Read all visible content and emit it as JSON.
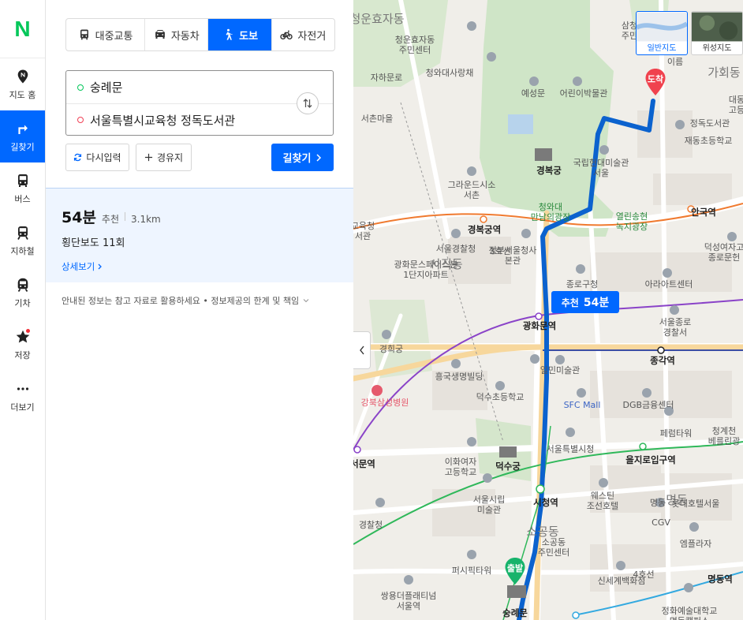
{
  "rail": {
    "logo": "N",
    "items": [
      {
        "icon": "map-pin-icon",
        "label": "지도 홈"
      },
      {
        "icon": "directions-icon",
        "label": "길찾기"
      },
      {
        "icon": "bus-icon",
        "label": "버스"
      },
      {
        "icon": "subway-icon",
        "label": "지하철"
      },
      {
        "icon": "train-icon",
        "label": "기차"
      },
      {
        "icon": "star-icon",
        "label": "저장"
      },
      {
        "icon": "more-icon",
        "label": "더보기"
      }
    ]
  },
  "modes": [
    {
      "icon": "bus-icon",
      "label": "대중교통"
    },
    {
      "icon": "car-icon",
      "label": "자동차"
    },
    {
      "icon": "walk-icon",
      "label": "도보"
    },
    {
      "icon": "bicycle-icon",
      "label": "자전거"
    }
  ],
  "route": {
    "origin": "숭례문",
    "destination": "서울특별시교육청 정독도서관"
  },
  "actions": {
    "reset_label": "다시입력",
    "waypoint_label": "경유지",
    "search_label": "길찾기"
  },
  "result": {
    "time": "54분",
    "recommend": "추천",
    "distance": "3.1km",
    "crosswalks": "횡단보도 11회",
    "detail_label": "상세보기"
  },
  "notice": "안내된 정보는 참고 자료로 활용하세요 • 정보제공의 한계 및 책임",
  "map": {
    "layers": [
      {
        "label": "일반지도",
        "active": true
      },
      {
        "label": "위성지도",
        "active": false
      }
    ],
    "route_badge": {
      "tag": "추천",
      "time": "54분"
    },
    "start_pin": "출발",
    "end_pin": "도착",
    "labels": [
      {
        "text": "청운효자동",
        "cls": "big"
      },
      {
        "text": "청운효자동\n주민센터"
      },
      {
        "text": "청와대사랑채"
      },
      {
        "text": "예성문"
      },
      {
        "text": "어린이박물관"
      },
      {
        "text": "서촌마을"
      },
      {
        "text": "경복궁",
        "cls": "bold"
      },
      {
        "text": "국립현대미술관\n서울"
      },
      {
        "text": "그라운드시소\n서촌"
      },
      {
        "text": "청와대\n만남의광장",
        "cls": "green"
      },
      {
        "text": "열린송현\n녹지광장",
        "cls": "green"
      },
      {
        "text": "경복궁역",
        "cls": "bold"
      },
      {
        "text": "안국역",
        "cls": "bold"
      },
      {
        "text": "서울경찰청"
      },
      {
        "text": "정부서울청사\n본관"
      },
      {
        "text": "광화문스페이스본\n1단지아파트"
      },
      {
        "text": "사직동",
        "cls": "big"
      },
      {
        "text": "종로구청"
      },
      {
        "text": "아라아트센터"
      },
      {
        "text": "광화문역",
        "cls": "bold"
      },
      {
        "text": "종각역",
        "cls": "bold"
      },
      {
        "text": "서울종로\n경찰서"
      },
      {
        "text": "경희궁"
      },
      {
        "text": "흥국생명빌딩"
      },
      {
        "text": "일민미술관"
      },
      {
        "text": "덕수초등학교"
      },
      {
        "text": "SFC Mall",
        "cls": "blue"
      },
      {
        "text": "DGB금융센터"
      },
      {
        "text": "강북삼성병원",
        "cls": "red"
      },
      {
        "text": "페럼타워"
      },
      {
        "text": "서울특별시청"
      },
      {
        "text": "을지로입구역",
        "cls": "bold"
      },
      {
        "text": "덕수궁",
        "cls": "bold"
      },
      {
        "text": "이화여자\n고등학교"
      },
      {
        "text": "서울시립\n미술관"
      },
      {
        "text": "시청역",
        "cls": "bold"
      },
      {
        "text": "웨스틴\n조선호텔"
      },
      {
        "text": "명동",
        "cls": "big"
      },
      {
        "text": "명동"
      },
      {
        "text": "롯데호텔서울"
      },
      {
        "text": "CGV"
      },
      {
        "text": "소공동",
        "cls": "big"
      },
      {
        "text": "소공동\n주민센터"
      },
      {
        "text": "엠플라자"
      },
      {
        "text": "퍼시픽타워"
      },
      {
        "text": "신세계백화점"
      },
      {
        "text": "명동역",
        "cls": "bold"
      },
      {
        "text": "쌍용더플래티넘\n서울역"
      },
      {
        "text": "숭례문",
        "cls": "bold"
      },
      {
        "text": "정화예술대학교\n명동캠퍼스"
      },
      {
        "text": "경찰청"
      },
      {
        "text": "가회동",
        "cls": "big"
      },
      {
        "text": "재동초등학교"
      },
      {
        "text": "정독도서관"
      },
      {
        "text": "덕성여자고\n종로문헌"
      },
      {
        "text": "청계천\n베를린광"
      },
      {
        "text": "교육청\n서관"
      },
      {
        "text": "서문역",
        "cls": "bold"
      },
      {
        "text": "자하문로"
      },
      {
        "text": "3호선"
      },
      {
        "text": "4호선"
      },
      {
        "text": "삼청\n주민"
      },
      {
        "text": "이름"
      },
      {
        "text": "대동\n고등"
      }
    ]
  },
  "colors": {
    "accent": "#0068ff",
    "brand": "#03c75a",
    "route": "#0b62ce",
    "line3": "#f07a2f",
    "line5": "#8a43c8",
    "line2": "#2fb85a",
    "line1": "#3c4ea3"
  }
}
